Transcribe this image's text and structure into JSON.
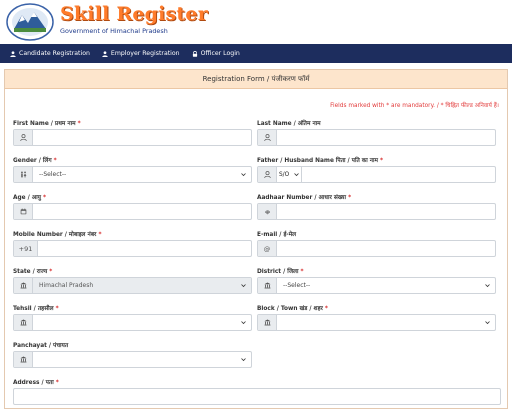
{
  "brand": {
    "title": "Skill Register",
    "subtitle": "Government of Himachal Pradesh"
  },
  "nav": {
    "items": [
      {
        "label": "Candidate Registration",
        "icon": "user-icon"
      },
      {
        "label": "Employer Registration",
        "icon": "user-icon"
      },
      {
        "label": "Officer Login",
        "icon": "lock-icon"
      }
    ]
  },
  "form": {
    "title": "Registration Form / पंजीकरण फॉर्म",
    "mandatory_note": "Fields marked with * are mandatory. / * चिह्नित फील्ड अनिवार्य हैं।",
    "first_name": {
      "label": "First Name / प्रथम नाम",
      "req": "*",
      "value": ""
    },
    "last_name": {
      "label": "Last Name / अंतिम नाम",
      "value": ""
    },
    "gender": {
      "label": "Gender / लिंग",
      "req": "*",
      "selected": "--Select--"
    },
    "father_name": {
      "label": "Father / Husband Name   पिता / पति का नाम",
      "req": "*",
      "prefix": "S/O",
      "value": ""
    },
    "age": {
      "label": "Age / आयु",
      "req": "*",
      "value": ""
    },
    "aadhaar": {
      "label": "Aadhaar Number / आधार संख्या",
      "req": "*",
      "value": ""
    },
    "mobile": {
      "label": "Mobile Number / मोबाइल नंबर",
      "req": "*",
      "prefix": "+91",
      "value": ""
    },
    "email": {
      "label": "E-mail / ई-मेल",
      "prefix": "@",
      "value": ""
    },
    "state": {
      "label": "State / राज्य",
      "req": "*",
      "selected": "Himachal Pradesh"
    },
    "district": {
      "label": "District / जिला",
      "req": "*",
      "selected": "--Select--"
    },
    "tehsil": {
      "label": "Tehsil / तहसील",
      "req": "*",
      "selected": ""
    },
    "block": {
      "label": "Block / Town   खंड / शहर",
      "req": "*",
      "selected": ""
    },
    "panchayat": {
      "label": "Panchayat / पंचायत",
      "selected": ""
    },
    "address": {
      "label": "Address / पता",
      "req": "*",
      "value": ""
    }
  }
}
